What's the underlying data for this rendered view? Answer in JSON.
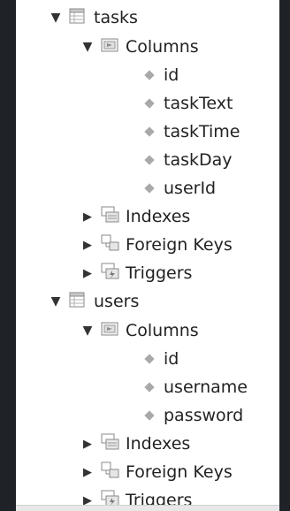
{
  "tree": {
    "tables": [
      {
        "name": "tasks",
        "columns_label": "Columns",
        "columns": [
          "id",
          "taskText",
          "taskTime",
          "taskDay",
          "userId"
        ],
        "indexes_label": "Indexes",
        "foreign_keys_label": "Foreign Keys",
        "triggers_label": "Triggers"
      },
      {
        "name": "users",
        "columns_label": "Columns",
        "columns": [
          "id",
          "username",
          "password"
        ],
        "indexes_label": "Indexes",
        "foreign_keys_label": "Foreign Keys",
        "triggers_label": "Triggers"
      }
    ]
  },
  "icons": {
    "expanded": "triangle-down-icon",
    "collapsed": "triangle-right-icon",
    "table": "table-icon",
    "columns": "columns-folder-icon",
    "indexes": "indexes-icon",
    "foreign_keys": "foreign-keys-icon",
    "triggers": "triggers-icon",
    "column": "column-diamond-icon"
  }
}
